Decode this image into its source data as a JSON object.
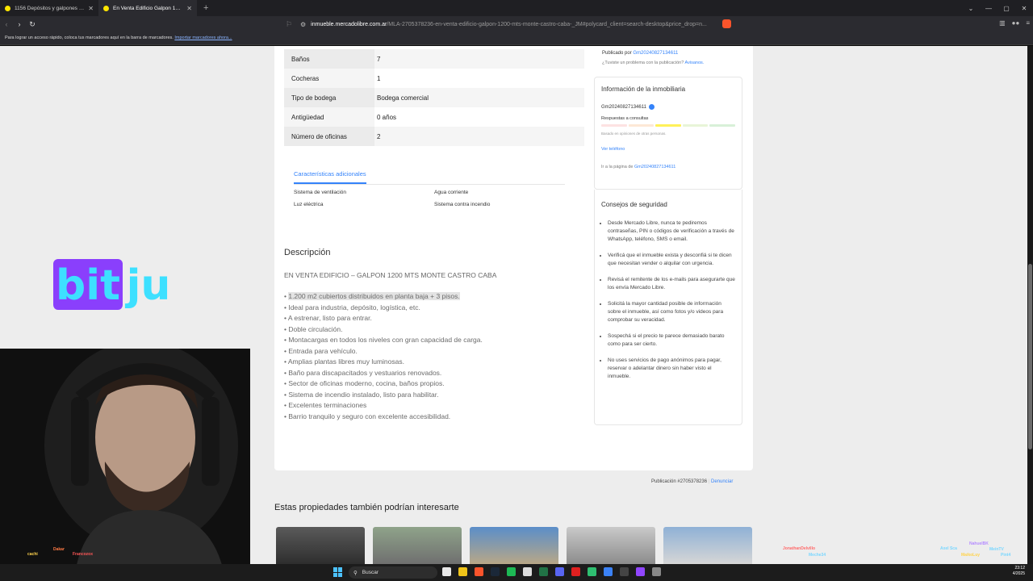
{
  "browser": {
    "tabs": [
      {
        "label": "1156 Depósitos y galpones en Venta",
        "active": false
      },
      {
        "label": "En Venta Edificio Galpon 1200 M",
        "active": true
      }
    ],
    "url_host": "inmueble.mercadolibre.com.ar",
    "url_path": "/MLA-2705378236-en-venta-edificio-galpon-1200-mts-monte-castro-caba-_JM#polycard_client=search-desktop&price_drop=n...",
    "bookmarks_text": "Para lograr un acceso rápido, coloca tus marcadores aquí en la barra de marcadores.",
    "bookmarks_link": "Importar marcadores ahora..."
  },
  "specs": [
    {
      "key": "Baños",
      "value": "7"
    },
    {
      "key": "Cocheras",
      "value": "1"
    },
    {
      "key": "Tipo de bodega",
      "value": "Bodega comercial"
    },
    {
      "key": "Antigüedad",
      "value": "0 años"
    },
    {
      "key": "Número de oficinas",
      "value": "2"
    }
  ],
  "additional": {
    "tab_label": "Características adicionales",
    "features": [
      "Sistema de ventilación",
      "Agua corriente",
      "Luz eléctrica",
      "Sistema contra incendio"
    ]
  },
  "description": {
    "title": "Descripción",
    "subtitle": "EN VENTA EDIFICIO – GALPON 1200 MTS MONTE CASTRO CABA",
    "items": [
      "1.200 m2 cubiertos distribuidos en planta baja + 3 pisos.",
      "Ideal para industria, depósito, logística, etc.",
      "A estrenar, listo para entrar.",
      "Doble circulación.",
      "Montacargas en todos los niveles con gran capacidad de carga.",
      "Entrada para vehículo.",
      "Amplias plantas libres muy luminosas.",
      "Baño para discapacitados y vestuarios renovados.",
      "Sector de oficinas moderno, cocina, baños propios.",
      "Sistema de incendio instalado, listo para habilitar.",
      "Excelentes terminaciones",
      "Barrio tranquilo y seguro con excelente accesibilidad."
    ]
  },
  "seller": {
    "published_by_label": "Publicado por",
    "seller_id": "Gm20240827134611",
    "problem_text": "¿Tuviste un problema con la publicación?",
    "problem_link": "Avisanos.",
    "info_title": "Información de la inmobiliaria",
    "responses_label": "Respuestas a consultas",
    "based_text": "Basado en opiniones de otras personas.",
    "phone_link": "Ver teléfono",
    "goto_text": "Ir a la página de"
  },
  "safety": {
    "title": "Consejos de seguridad",
    "tips": [
      "Desde Mercado Libre, nunca te pediremos contraseñas, PIN o códigos de verificación a través de WhatsApp, teléfono, SMS o email.",
      "Verificá que el inmueble exista y desconfiá si te dicen que necesitan vender o alquilar con urgencia.",
      "Revisá el remitente de los e-mails para asegurarte que los envía Mercado Libre.",
      "Solicitá la mayor cantidad posible de información sobre el inmueble, así como fotos y/o videos para comprobar su veracidad.",
      "Sospechá si el precio te parece demasiado barato como para ser cierto.",
      "No uses servicios de pago anónimos para pagar, reservar o adelantar dinero sin haber visto el inmueble."
    ]
  },
  "footer": {
    "publication_label": "Publicación",
    "publication_id": "#2705378236",
    "report_link": "Denunciar"
  },
  "similar_title": "Estas propiedades también podrían interesarte",
  "overlay": {
    "logo_left": "bit",
    "logo_right": "ju",
    "chat_names_left": [
      "cachi",
      "Dakar",
      "Francozox"
    ],
    "chat_names_right": [
      "JonathanDelvillo",
      "Meche34",
      "Axel Sca",
      "NahuelBK",
      "MeinTV",
      "MaikoLuy",
      "Pint4"
    ]
  },
  "taskbar": {
    "search_label": "Buscar",
    "time": "23:12",
    "date": "4/2025"
  },
  "colors": {
    "accent": "#3483fa",
    "logo_purple": "#8a3ffc",
    "logo_cyan": "#3de0ff"
  }
}
